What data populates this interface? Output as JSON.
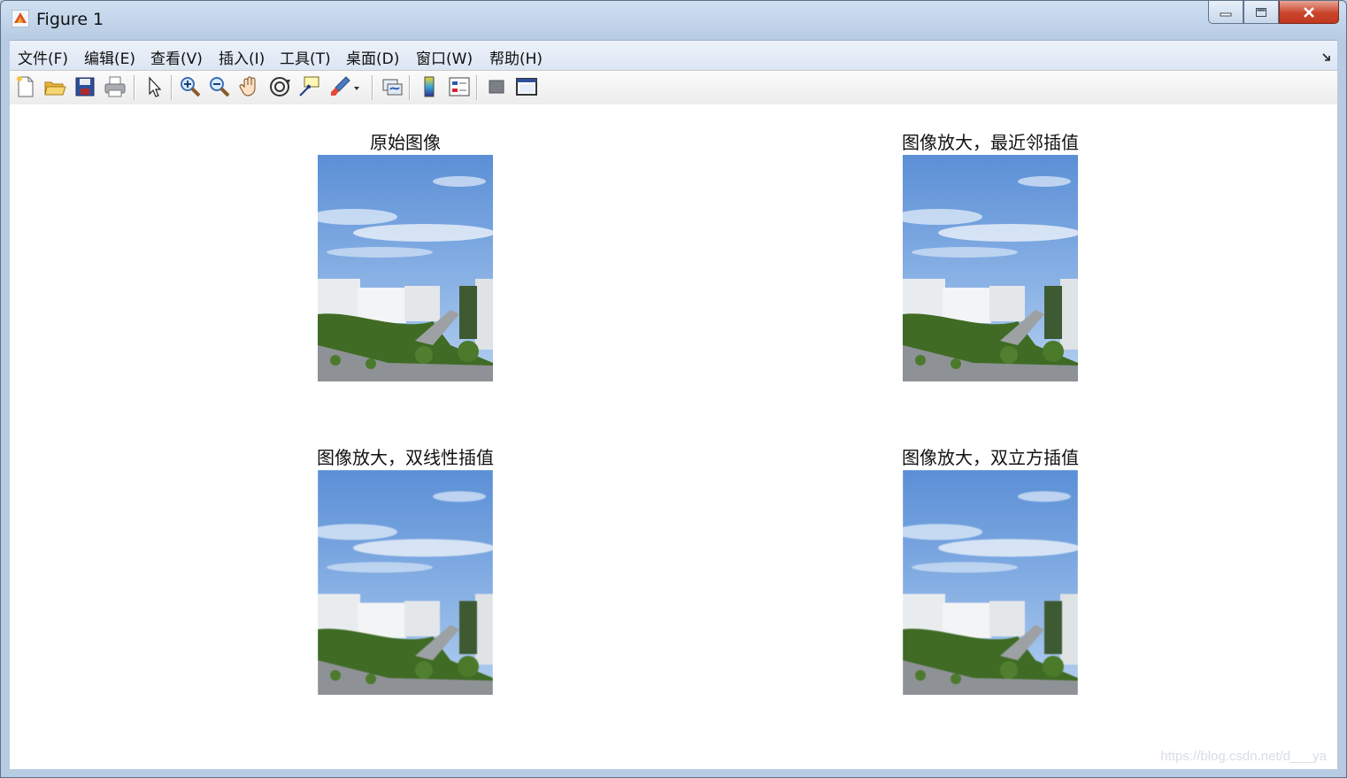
{
  "window": {
    "title": "Figure 1"
  },
  "menu": [
    {
      "label": "文件(F)"
    },
    {
      "label": "编辑(E)"
    },
    {
      "label": "查看(V)"
    },
    {
      "label": "插入(I)"
    },
    {
      "label": "工具(T)"
    },
    {
      "label": "桌面(D)"
    },
    {
      "label": "窗口(W)"
    },
    {
      "label": "帮助(H)"
    }
  ],
  "toolbar": [
    {
      "icon": "new-figure-icon"
    },
    {
      "icon": "open-file-icon"
    },
    {
      "icon": "save-icon"
    },
    {
      "icon": "print-icon"
    },
    {
      "icon": "edit-plot-arrow-icon"
    },
    {
      "icon": "zoom-in-icon"
    },
    {
      "icon": "zoom-out-icon"
    },
    {
      "icon": "pan-hand-icon"
    },
    {
      "icon": "rotate-3d-icon"
    },
    {
      "icon": "data-cursor-icon"
    },
    {
      "icon": "brush-icon"
    },
    {
      "icon": "link-plot-icon"
    },
    {
      "icon": "insert-colorbar-icon"
    },
    {
      "icon": "insert-legend-icon"
    },
    {
      "icon": "hide-plot-tools-icon"
    },
    {
      "icon": "show-plot-tools-icon"
    }
  ],
  "figure": {
    "panels": [
      {
        "title": "原始图像"
      },
      {
        "title": "图像放大，最近邻插值"
      },
      {
        "title": "图像放大，双线性插值"
      },
      {
        "title": "图像放大，双立方插值"
      }
    ],
    "watermark": "https://blog.csdn.net/d___ya"
  },
  "colors": {
    "sky_top": "#5b8fd6",
    "sky_bottom": "#a9c8ec",
    "trees": "#3f6b25",
    "building": "#e9ecef"
  }
}
